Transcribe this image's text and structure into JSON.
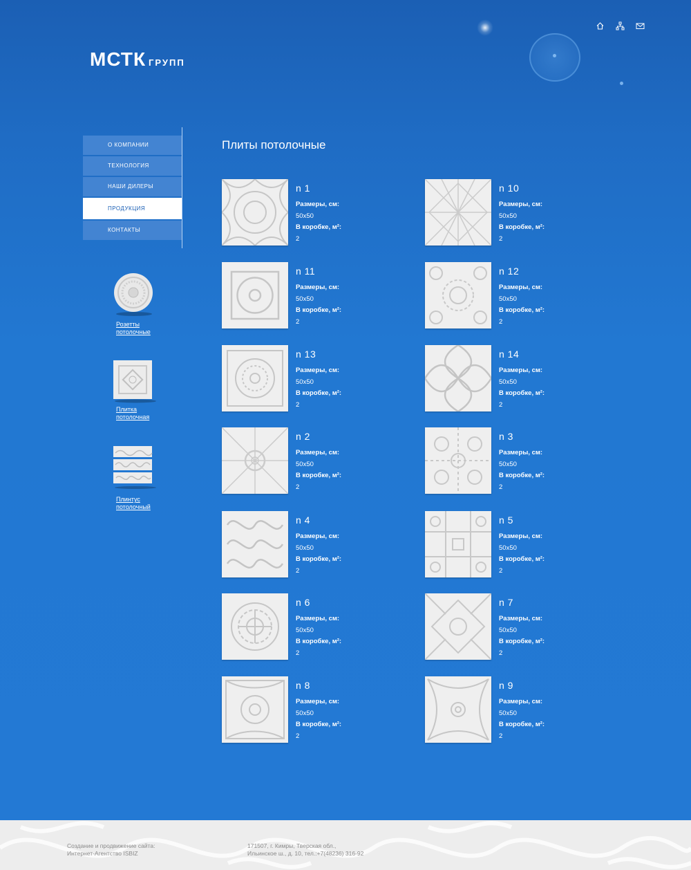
{
  "logo": {
    "main": "МСТК",
    "sub": "ГРУПП"
  },
  "top_icons": [
    "home-icon",
    "sitemap-icon",
    "mail-icon"
  ],
  "nav": [
    {
      "label": "О КОМПАНИИ",
      "active": false
    },
    {
      "label": "ТЕХНОЛОГИЯ",
      "active": false
    },
    {
      "label": "НАШИ ДИЛЕРЫ",
      "active": false
    },
    {
      "label": "ПРОДУКЦИЯ",
      "active": true
    },
    {
      "label": "КОНТАКТЫ",
      "active": false
    }
  ],
  "side_products": [
    {
      "line1": "Розетты",
      "line2": "потолочные",
      "icon": "rosette-icon"
    },
    {
      "line1": "Плитка",
      "line2": "потолочная",
      "icon": "tile-icon"
    },
    {
      "line1": "Плинтус",
      "line2": "потолочный",
      "icon": "plinth-icon"
    }
  ],
  "page_title": "Плиты потолочные",
  "labels": {
    "size": "Размеры, см:",
    "box": "В коробке, м²:"
  },
  "products": [
    {
      "name": "n 1",
      "size": "50x50",
      "box": "2"
    },
    {
      "name": "n 10",
      "size": "50x50",
      "box": "2"
    },
    {
      "name": "n 11",
      "size": "50x50",
      "box": "2"
    },
    {
      "name": "n 12",
      "size": "50x50",
      "box": "2"
    },
    {
      "name": "n 13",
      "size": "50x50",
      "box": "2"
    },
    {
      "name": "n 14",
      "size": "50x50",
      "box": "2"
    },
    {
      "name": "n 2",
      "size": "50x50",
      "box": "2"
    },
    {
      "name": "n 3",
      "size": "50x50",
      "box": "2"
    },
    {
      "name": "n 4",
      "size": "50x50",
      "box": "2"
    },
    {
      "name": "n 5",
      "size": "50x50",
      "box": "2"
    },
    {
      "name": "n 6",
      "size": "50x50",
      "box": "2"
    },
    {
      "name": "n 7",
      "size": "50x50",
      "box": "2"
    },
    {
      "name": "n 8",
      "size": "50x50",
      "box": "2"
    },
    {
      "name": "n 9",
      "size": "50x50",
      "box": "2"
    }
  ],
  "footer": {
    "credit_line1": "Создание и продвижение сайта:",
    "credit_line2": "Интернет-Агентство ISBIZ",
    "address_line1": "171507, г. Кимры, Тверская обл.,",
    "address_line2": "Ильинское ш., д. 10, тел.:+7(48236) 316-92"
  }
}
